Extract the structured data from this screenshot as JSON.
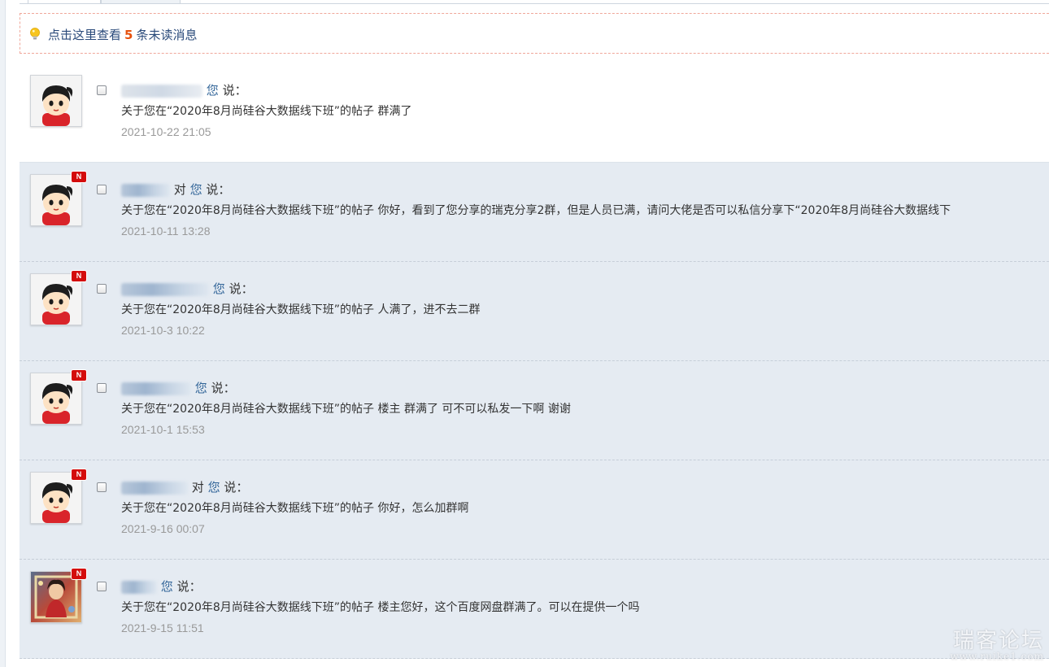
{
  "notice": {
    "prefix": "点击这里查看",
    "count": "5",
    "suffix": "条未读消息"
  },
  "messages": [
    {
      "to_you": "您",
      "says": "说：",
      "body": "关于您在“2020年8月尚硅谷大数据线下班”的帖子 群满了",
      "time": "2021-10-22 21:05",
      "unread": false
    },
    {
      "to_you_prefix": "对",
      "to_you": "您",
      "says": "说：",
      "body": "关于您在“2020年8月尚硅谷大数据线下班”的帖子 你好，看到了您分享的瑞克分享2群，但是人员已满，请问大佬是否可以私信分享下“2020年8月尚硅谷大数据线下",
      "time": "2021-10-11 13:28",
      "unread": true
    },
    {
      "to_you": "您",
      "says": "说：",
      "body": "关于您在“2020年8月尚硅谷大数据线下班”的帖子 人满了，进不去二群",
      "time": "2021-10-3 10:22",
      "unread": true
    },
    {
      "to_you": "您",
      "says": "说：",
      "body": "关于您在“2020年8月尚硅谷大数据线下班”的帖子 楼主 群满了 可不可以私发一下啊 谢谢",
      "time": "2021-10-1 15:53",
      "unread": true
    },
    {
      "to_you_prefix": "对",
      "to_you": "您",
      "says": "说：",
      "body": "关于您在“2020年8月尚硅谷大数据线下班”的帖子 你好，怎么加群啊",
      "time": "2021-9-16 00:07",
      "unread": true
    },
    {
      "to_you": "您",
      "says": "说：",
      "body": "关于您在“2020年8月尚硅谷大数据线下班”的帖子 楼主您好，这个百度网盘群满了。可以在提供一个吗",
      "time": "2021-9-15 11:51",
      "unread": true
    }
  ],
  "badge_label": "N",
  "watermark": {
    "main": "瑞客论坛",
    "url": "www.ruike1.com"
  },
  "colors": {
    "unread_background": "#e5ebf2",
    "link_blue": "#336699",
    "count_orange": "#e6500c",
    "badge_red": "#d40c0c",
    "time_gray": "#999999"
  }
}
